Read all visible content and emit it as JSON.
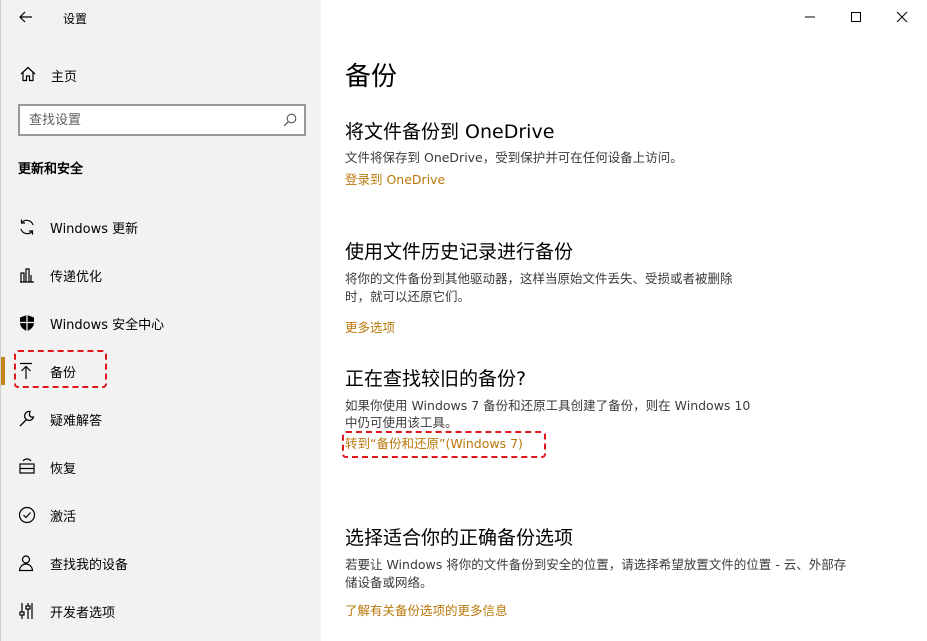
{
  "window": {
    "title": "设置",
    "controls": {
      "minimize": "minimize-icon",
      "maximize": "maximize-icon",
      "close": "close-icon"
    }
  },
  "sidebar": {
    "home_label": "主页",
    "search_placeholder": "查找设置",
    "section_title": "更新和安全",
    "items": [
      {
        "label": "Windows 更新",
        "icon": "sync-icon"
      },
      {
        "label": "传递优化",
        "icon": "delivery-icon"
      },
      {
        "label": "Windows 安全中心",
        "icon": "shield-icon"
      },
      {
        "label": "备份",
        "icon": "backup-icon",
        "active": true
      },
      {
        "label": "疑难解答",
        "icon": "wrench-icon"
      },
      {
        "label": "恢复",
        "icon": "recovery-icon"
      },
      {
        "label": "激活",
        "icon": "check-circle-icon"
      },
      {
        "label": "查找我的设备",
        "icon": "person-locate-icon"
      },
      {
        "label": "开发者选项",
        "icon": "dev-options-icon"
      }
    ]
  },
  "main": {
    "title": "备份",
    "sections": [
      {
        "heading": "将文件备份到 OneDrive",
        "description": "文件将保存到 OneDrive，受到保护并可在任何设备上访问。",
        "link": "登录到 OneDrive"
      },
      {
        "heading": "使用文件历史记录进行备份",
        "description_line1": "将你的文件备份到其他驱动器，这样当原始文件丢失、受损或者被删除",
        "description_line2": "时，就可以还原它们。",
        "link": "更多选项"
      },
      {
        "heading": "正在查找较旧的备份?",
        "description_line1": "如果你使用 Windows 7 备份和还原工具创建了备份，则在 Windows 10",
        "description_line2": "中仍可使用该工具。",
        "link": "转到“备份和还原”(Windows 7)"
      },
      {
        "heading": "选择适合你的正确备份选项",
        "description_line1": "若要让 Windows 将你的文件备份到安全的位置，请选择希望放置文件的位置 - 云、外部存",
        "description_line2": "储设备或网络。",
        "link": "了解有关备份选项的更多信息"
      }
    ]
  },
  "colors": {
    "accent": "#c1851c",
    "link": "#b9780b",
    "annotation": "#e2141c",
    "sidebar_bg": "#f2f2f2"
  }
}
